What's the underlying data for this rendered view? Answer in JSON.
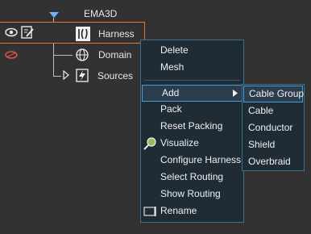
{
  "tree": {
    "root_label": "EMA3D",
    "items": [
      {
        "label": "Harness",
        "icon": "harness-icon"
      },
      {
        "label": "Domain",
        "icon": "globe-icon"
      },
      {
        "label": "Sources",
        "icon": "lightning-icon"
      }
    ]
  },
  "context_menu": {
    "items": [
      {
        "label": "Delete"
      },
      {
        "label": "Mesh"
      },
      {
        "label": "Add"
      },
      {
        "label": "Pack"
      },
      {
        "label": "Reset Packing"
      },
      {
        "label": "Visualize"
      },
      {
        "label": "Configure Harness"
      },
      {
        "label": "Select Routing"
      },
      {
        "label": "Show Routing"
      },
      {
        "label": "Rename"
      }
    ]
  },
  "submenu": {
    "items": [
      {
        "label": "Cable Group"
      },
      {
        "label": "Cable"
      },
      {
        "label": "Conductor"
      },
      {
        "label": "Shield"
      },
      {
        "label": "Overbraid"
      }
    ]
  },
  "colors": {
    "background": "#323232",
    "menu_bg": "#1f2b35",
    "highlight_border": "#4b9bd6",
    "selection_border": "#e07a2e"
  }
}
